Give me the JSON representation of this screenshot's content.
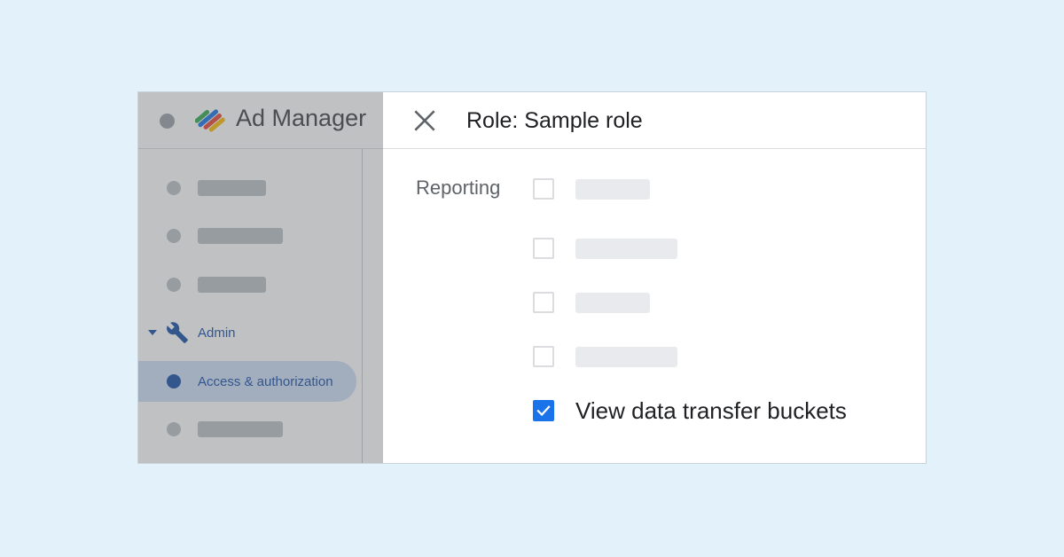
{
  "app": {
    "product_name": "Ad Manager",
    "nav": {
      "admin_label": "Admin",
      "active_item_label": "Access & authorization"
    }
  },
  "dialog": {
    "title": "Role: Sample role",
    "section_label": "Reporting",
    "permissions": [
      {
        "label": "",
        "checked": false
      },
      {
        "label": "",
        "checked": false
      },
      {
        "label": "",
        "checked": false
      },
      {
        "label": "",
        "checked": false
      },
      {
        "label": "View data transfer buckets",
        "checked": true
      }
    ]
  },
  "colors": {
    "background": "#e2f1fa",
    "accent": "#1a73e8",
    "nav_active": "#174ea6",
    "nav_active_bg": "#cfe0f7",
    "placeholder": "#e8eaed"
  },
  "icons": {
    "logo": "ad-manager-logo",
    "close": "close-icon",
    "admin": "wrench-icon",
    "checkmark": "check-icon"
  }
}
